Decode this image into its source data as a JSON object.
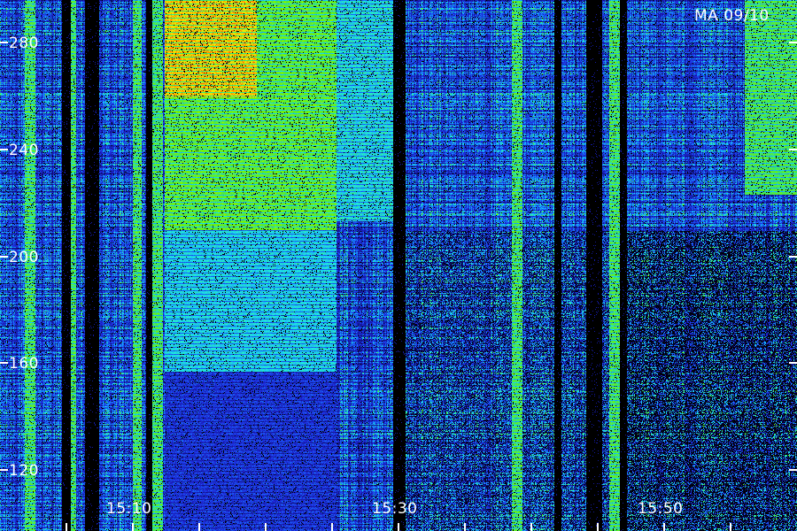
{
  "corner_label": "MA 09/10",
  "frequency_axis": {
    "ticks": [
      {
        "value": 280,
        "label": "280"
      },
      {
        "value": 240,
        "label": "240"
      },
      {
        "value": 200,
        "label": "200"
      },
      {
        "value": 160,
        "label": "160"
      },
      {
        "value": 120,
        "label": "120"
      }
    ]
  },
  "time_axis": {
    "labels": [
      "15:10",
      "15:30",
      "15:50"
    ]
  },
  "colors": {
    "background": "#000000",
    "text": "#ffffff",
    "low": "#0a0a60",
    "mid": "#1fb8ff",
    "high_green": "#6cf000",
    "high_yellow": "#ffe000",
    "peak": "#ff2000"
  }
}
